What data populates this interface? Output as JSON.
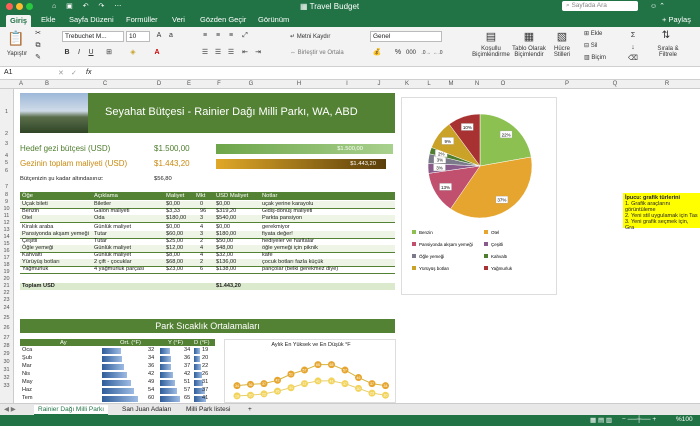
{
  "app": {
    "title": "Travel Budget",
    "search_placeholder": "Sayfada Ara"
  },
  "ribbon_tabs": [
    "Giriş",
    "Ekle",
    "Sayfa Düzeni",
    "Formüller",
    "Veri",
    "Gözden Geçir",
    "Görünüm"
  ],
  "share_label": "+ Paylaş",
  "ribbon": {
    "paste": "Yapıştır",
    "font_name": "Trebuchet M...",
    "font_size": "10",
    "wrap_text": "Metni Kaydır",
    "merge_center": "Birleştir ve Ortala",
    "number_format": "Genel",
    "conditional": "Koşullu Biçimlendirme",
    "format_table": "Tablo Olarak Biçimlendir",
    "cell_styles": "Hücre Stilleri",
    "insert": "Ekle",
    "delete": "Sil",
    "format": "Biçim",
    "sort_filter": "Sırala & Filtrele"
  },
  "formula_bar": {
    "cell_ref": "A1",
    "fx": "fx",
    "value": ""
  },
  "columns": [
    "A",
    "B",
    "C",
    "D",
    "E",
    "F",
    "G",
    "H",
    "I",
    "J",
    "K",
    "L",
    "M",
    "N",
    "O",
    "P",
    "Q",
    "R"
  ],
  "rows": [
    "1",
    "2",
    "3",
    "4",
    "5",
    "6",
    "7",
    "8",
    "9",
    "10",
    "11",
    "12",
    "13",
    "14",
    "15",
    "16",
    "17",
    "18",
    "19",
    "20",
    "21",
    "22",
    "23",
    "24",
    "25",
    "26",
    "27",
    "28",
    "29",
    "30",
    "31",
    "32",
    "33"
  ],
  "banner_title": "Seyahat Bütçesi - Rainier Dağı Milli Parkı, WA, ABD",
  "budget": {
    "target_label": "Hedef gezi bütçesi (USD)",
    "target_value": "1.500,00",
    "target_bar": "$1.500,00",
    "total_label": "Gezinin toplam maliyeti (USD)",
    "total_value": "1.443,20",
    "total_bar": "$1.443,20",
    "under_label": "Bütçenizin şu kadar altındasınız:",
    "under_value": "$56,80",
    "currency": "$"
  },
  "table": {
    "headers": [
      "Öğe",
      "Açıklama",
      "Maliyet",
      "Mkt",
      "USD Maliyet",
      "Notlar"
    ],
    "rows": [
      [
        "Uçak bileti",
        "Biletler",
        "$0,00",
        "0",
        "$0,00",
        "uçak yerine karayolu"
      ],
      [
        "Benzin",
        "Galon maliyeti",
        "$3,33",
        "96",
        "$319,20",
        "Gidiş-dönüş maliyeti"
      ],
      [
        "Otel",
        "Oda",
        "$180,00",
        "3",
        "$540,00",
        "Parkta pansiyon"
      ],
      [
        "Kiralık araba",
        "Günlük maliyet",
        "$0,00",
        "4",
        "$0,00",
        "gerekmiyor"
      ],
      [
        "Pansiyonda akşam yemeği",
        "Tutar",
        "$60,00",
        "3",
        "$180,00",
        "fiyata değer!"
      ],
      [
        "Çeşitli",
        "Tutar",
        "$25,00",
        "2",
        "$50,00",
        "hediyeler ve haritalar"
      ],
      [
        "Öğle yemeği",
        "Günlük maliyet",
        "$12,00",
        "4",
        "$48,00",
        "öğle yemeği için piknik"
      ],
      [
        "Kahvaltı",
        "Günlük maliyet",
        "$8,00",
        "4",
        "$32,00",
        "kafe"
      ],
      [
        "Yürüyüş botları",
        "2 çift - çocuklar",
        "$68,00",
        "2",
        "$136,00",
        "çocuk botları fazla küçük"
      ],
      [
        "Yağmurluk",
        "4 yağmurluk parçası",
        "$23,00",
        "6",
        "$138,00",
        "pançolar (belki gerekmez diye)"
      ]
    ],
    "total_label": "Toplam USD",
    "total_value": "$1.443,20"
  },
  "pie_chart": {
    "legend": [
      "Benzin",
      "Otel",
      "Pansiyonda akşam yemeği",
      "Çeşitli",
      "Öğle yemeği",
      "Kahvaltı",
      "Yürüyüş botları",
      "Yağmurluk"
    ],
    "colors": [
      "#8cc152",
      "#e6a52e",
      "#c0506e",
      "#8a5a8a",
      "#7a7a8a",
      "#4e7d2e",
      "#c9a227",
      "#a83232"
    ]
  },
  "chart_data": [
    {
      "type": "pie",
      "categories": [
        "Benzin",
        "Otel",
        "Pansiyonda akşam yemeği",
        "Çeşitli",
        "Öğle yemeği",
        "Kahvaltı",
        "Yürüyüş botları",
        "Yağmurluk"
      ],
      "values": [
        22,
        37,
        13,
        3,
        3,
        2,
        9,
        10
      ],
      "labels": [
        "22%",
        "37%",
        "13%",
        "3%",
        "3%",
        "2%",
        "9%",
        "10%"
      ],
      "legend_position": "bottom"
    },
    {
      "type": "bar",
      "categories": [
        "Oca",
        "Şub",
        "Mar",
        "Nis",
        "May",
        "Haz",
        "Tem"
      ],
      "series": [
        {
          "name": "Ort. (°F)",
          "values": [
            32,
            34,
            36,
            42,
            49,
            54,
            60
          ]
        },
        {
          "name": "Y (°F)",
          "values": [
            34,
            36,
            37,
            42,
            51,
            57,
            65
          ]
        },
        {
          "name": "D (°F)",
          "values": [
            19,
            20,
            22,
            26,
            31,
            37,
            41
          ]
        }
      ]
    },
    {
      "type": "line",
      "title": "Aylık En Yüksek ve En Düşük °F",
      "series": [
        {
          "values": [
            34,
            36,
            37,
            42,
            51,
            57,
            65,
            65,
            57,
            46,
            37,
            34
          ]
        },
        {
          "values": [
            19,
            20,
            22,
            26,
            31,
            37,
            41,
            41,
            37,
            30,
            23,
            20
          ]
        }
      ]
    }
  ],
  "tip": {
    "title": "İpucu: grafik türlerini",
    "lines": [
      "1. Grafik araçlarını görüntüleme",
      "2. Yeni stil uygulamak için Tas",
      "3. Yeni grafik seçmek için, Gra"
    ]
  },
  "park": {
    "title": "Park Sıcaklık Ortalamaları",
    "headers": [
      "Ay",
      "Ort. (°F)",
      "Y (°F)",
      "D (°F)"
    ],
    "months": [
      "Oca",
      "Şub",
      "Mar",
      "Nis",
      "May",
      "Haz",
      "Tem"
    ]
  },
  "sheets": [
    "Rainier Dağı Milli Parkı",
    "San Juan Adaları",
    "Milli Park listesi"
  ],
  "add_sheet": "+",
  "status": {
    "zoom": "%100"
  }
}
